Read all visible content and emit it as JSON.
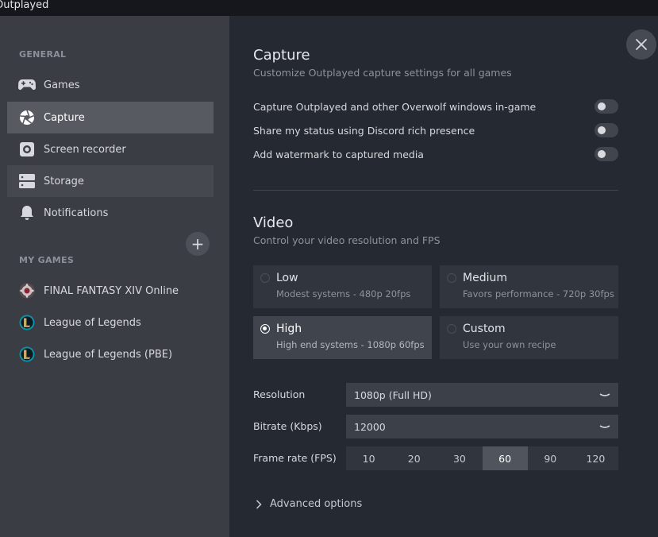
{
  "window": {
    "title": "Outplayed"
  },
  "sidebar": {
    "general_label": "GENERAL",
    "items": [
      {
        "label": "Games",
        "icon": "gamepad-icon"
      },
      {
        "label": "Capture",
        "icon": "aperture-icon"
      },
      {
        "label": "Screen recorder",
        "icon": "record-icon"
      },
      {
        "label": "Storage",
        "icon": "storage-icon"
      },
      {
        "label": "Notifications",
        "icon": "bell-icon"
      }
    ],
    "my_games_label": "MY GAMES",
    "add_game_symbol": "+",
    "games": [
      {
        "label": "FINAL FANTASY XIV Online",
        "icon": "ffxiv-icon"
      },
      {
        "label": "League of Legends",
        "icon": "lol-icon"
      },
      {
        "label": "League of Legends (PBE)",
        "icon": "lol-pbe-icon"
      }
    ]
  },
  "capture": {
    "title": "Capture",
    "subtitle": "Customize Outplayed capture settings for all games",
    "toggles": [
      {
        "label": "Capture Outplayed and other Overwolf windows in-game",
        "on": false
      },
      {
        "label": "Share my status using Discord rich presence",
        "on": false
      },
      {
        "label": "Add watermark to captured media",
        "on": false
      }
    ]
  },
  "video": {
    "title": "Video",
    "subtitle": "Control your video resolution and FPS",
    "presets": [
      {
        "name": "Low",
        "desc": "Modest systems - 480p 20fps",
        "selected": false
      },
      {
        "name": "Medium",
        "desc": "Favors performance - 720p 30fps",
        "selected": false
      },
      {
        "name": "High",
        "desc": "High end systems - 1080p 60fps",
        "selected": true
      },
      {
        "name": "Custom",
        "desc": "Use your own recipe",
        "selected": false
      }
    ],
    "resolution_label": "Resolution",
    "resolution_value": "1080p (Full HD)",
    "bitrate_label": "Bitrate (Kbps)",
    "bitrate_value": "12000",
    "framerate_label": "Frame rate (FPS)",
    "framerate_options": [
      "10",
      "20",
      "30",
      "60",
      "90",
      "120"
    ],
    "framerate_selected": "60",
    "advanced_label": "Advanced options"
  },
  "colors": {
    "sidebar_bg": "#3a3d44",
    "main_bg": "#252932",
    "active_item_bg": "#575a61",
    "lol_gold": "#c8aa6e",
    "lol_blue": "#0a96aa"
  }
}
